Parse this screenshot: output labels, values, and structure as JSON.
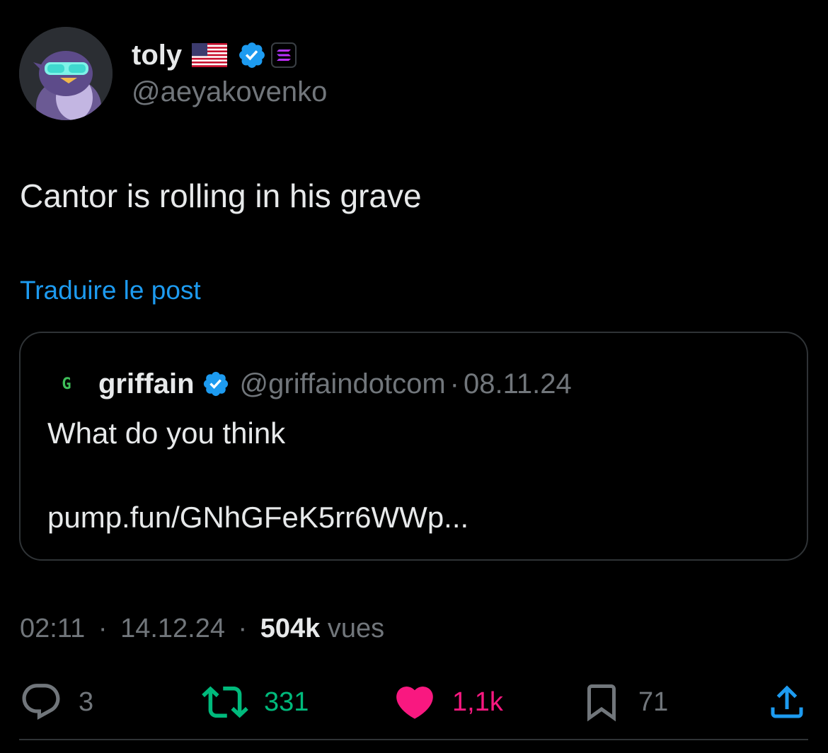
{
  "author": {
    "display_name": "toly",
    "handle": "@aeyakovenko",
    "flag_icon": "us-flag-icon",
    "verified_icon": "verified-badge-icon",
    "org_badge_icon": "solana-logo-icon"
  },
  "tweet": {
    "text": "Cantor is rolling in his grave",
    "translate_label": "Traduire le post"
  },
  "quote": {
    "logo_letter": "G",
    "display_name": "griffain",
    "handle": "@griffaindotcom",
    "separator": "·",
    "date": "08.11.24",
    "text": "What do you think",
    "link": "pump.fun/GNhGFeK5rr6WWp..."
  },
  "meta": {
    "time": "02:11",
    "separator": "·",
    "date": "14.12.24",
    "views_count": "504k",
    "views_label": "vues"
  },
  "actions": {
    "replies": "3",
    "reposts": "331",
    "likes": "1,1k",
    "bookmarks": "71"
  },
  "colors": {
    "background": "#000000",
    "text": "#e7e9ea",
    "muted": "#71767b",
    "link": "#1d9bf0",
    "verified": "#1d9bf0",
    "repost": "#00ba7c",
    "like": "#f91880"
  }
}
